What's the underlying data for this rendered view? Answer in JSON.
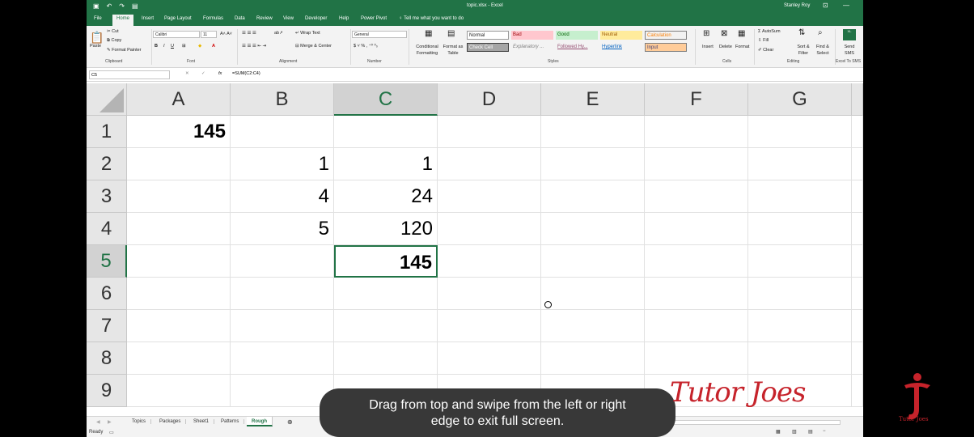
{
  "titlebar": {
    "doc_title": "topic.xlsx - Excel",
    "user": "Stanley Roy"
  },
  "tabs": [
    "File",
    "Home",
    "Insert",
    "Page Layout",
    "Formulas",
    "Data",
    "Review",
    "View",
    "Developer",
    "Help",
    "Power Pivot",
    "Tell me what you want to do"
  ],
  "ribbon": {
    "clipboard": {
      "cut": "Cut",
      "copy": "Copy",
      "paste": "Paste",
      "format_painter": "Format Painter",
      "label": "Clipboard"
    },
    "font": {
      "name": "Calibri",
      "size": "11",
      "label": "Font"
    },
    "alignment": {
      "wrap": "Wrap Text",
      "merge": "Merge & Center",
      "label": "Alignment"
    },
    "number": {
      "format": "General",
      "label": "Number"
    },
    "styles": {
      "conditional": "Conditional Formatting",
      "format_table": "Format as Table",
      "cells": [
        "Normal",
        "Bad",
        "Good",
        "Neutral",
        "Calculation",
        "Check Cell",
        "Explanatory ...",
        "Followed Hy...",
        "Hyperlink",
        "Input"
      ],
      "label": "Styles"
    },
    "cells_group": {
      "insert": "Insert",
      "delete": "Delete",
      "format": "Format",
      "label": "Cells"
    },
    "editing": {
      "autosum": "AutoSum",
      "fill": "Fill",
      "clear": "Clear",
      "sort": "Sort & Filter",
      "find": "Find & Select",
      "label": "Editing"
    },
    "sms": {
      "send": "Send SMS",
      "label": "Excel To SMS"
    }
  },
  "formulabar": {
    "name_box": "C5",
    "formula": "=SUM(C2:C4)",
    "fx": "fx"
  },
  "grid": {
    "columns": [
      "A",
      "B",
      "C",
      "D",
      "E",
      "F",
      "G"
    ],
    "rows": [
      "1",
      "2",
      "3",
      "4",
      "5",
      "6",
      "7",
      "8",
      "9"
    ],
    "cells": {
      "A1": "145",
      "B2": "1",
      "C2": "1",
      "B3": "4",
      "C3": "24",
      "B4": "5",
      "C4": "120",
      "C5": "145"
    }
  },
  "sheets": [
    "Topics",
    "Packages",
    "Sheet1",
    "Patterns",
    "Rough"
  ],
  "active_sheet": "Rough",
  "status": "Ready",
  "toast": {
    "line1": "Drag from top and swipe from the left or right",
    "line2": "edge to exit full screen."
  },
  "watermark": "Tutor Joes",
  "logo_text": "Tutor Joes",
  "colors": {
    "excel_green": "#217346",
    "brand_red": "#c6232b"
  }
}
